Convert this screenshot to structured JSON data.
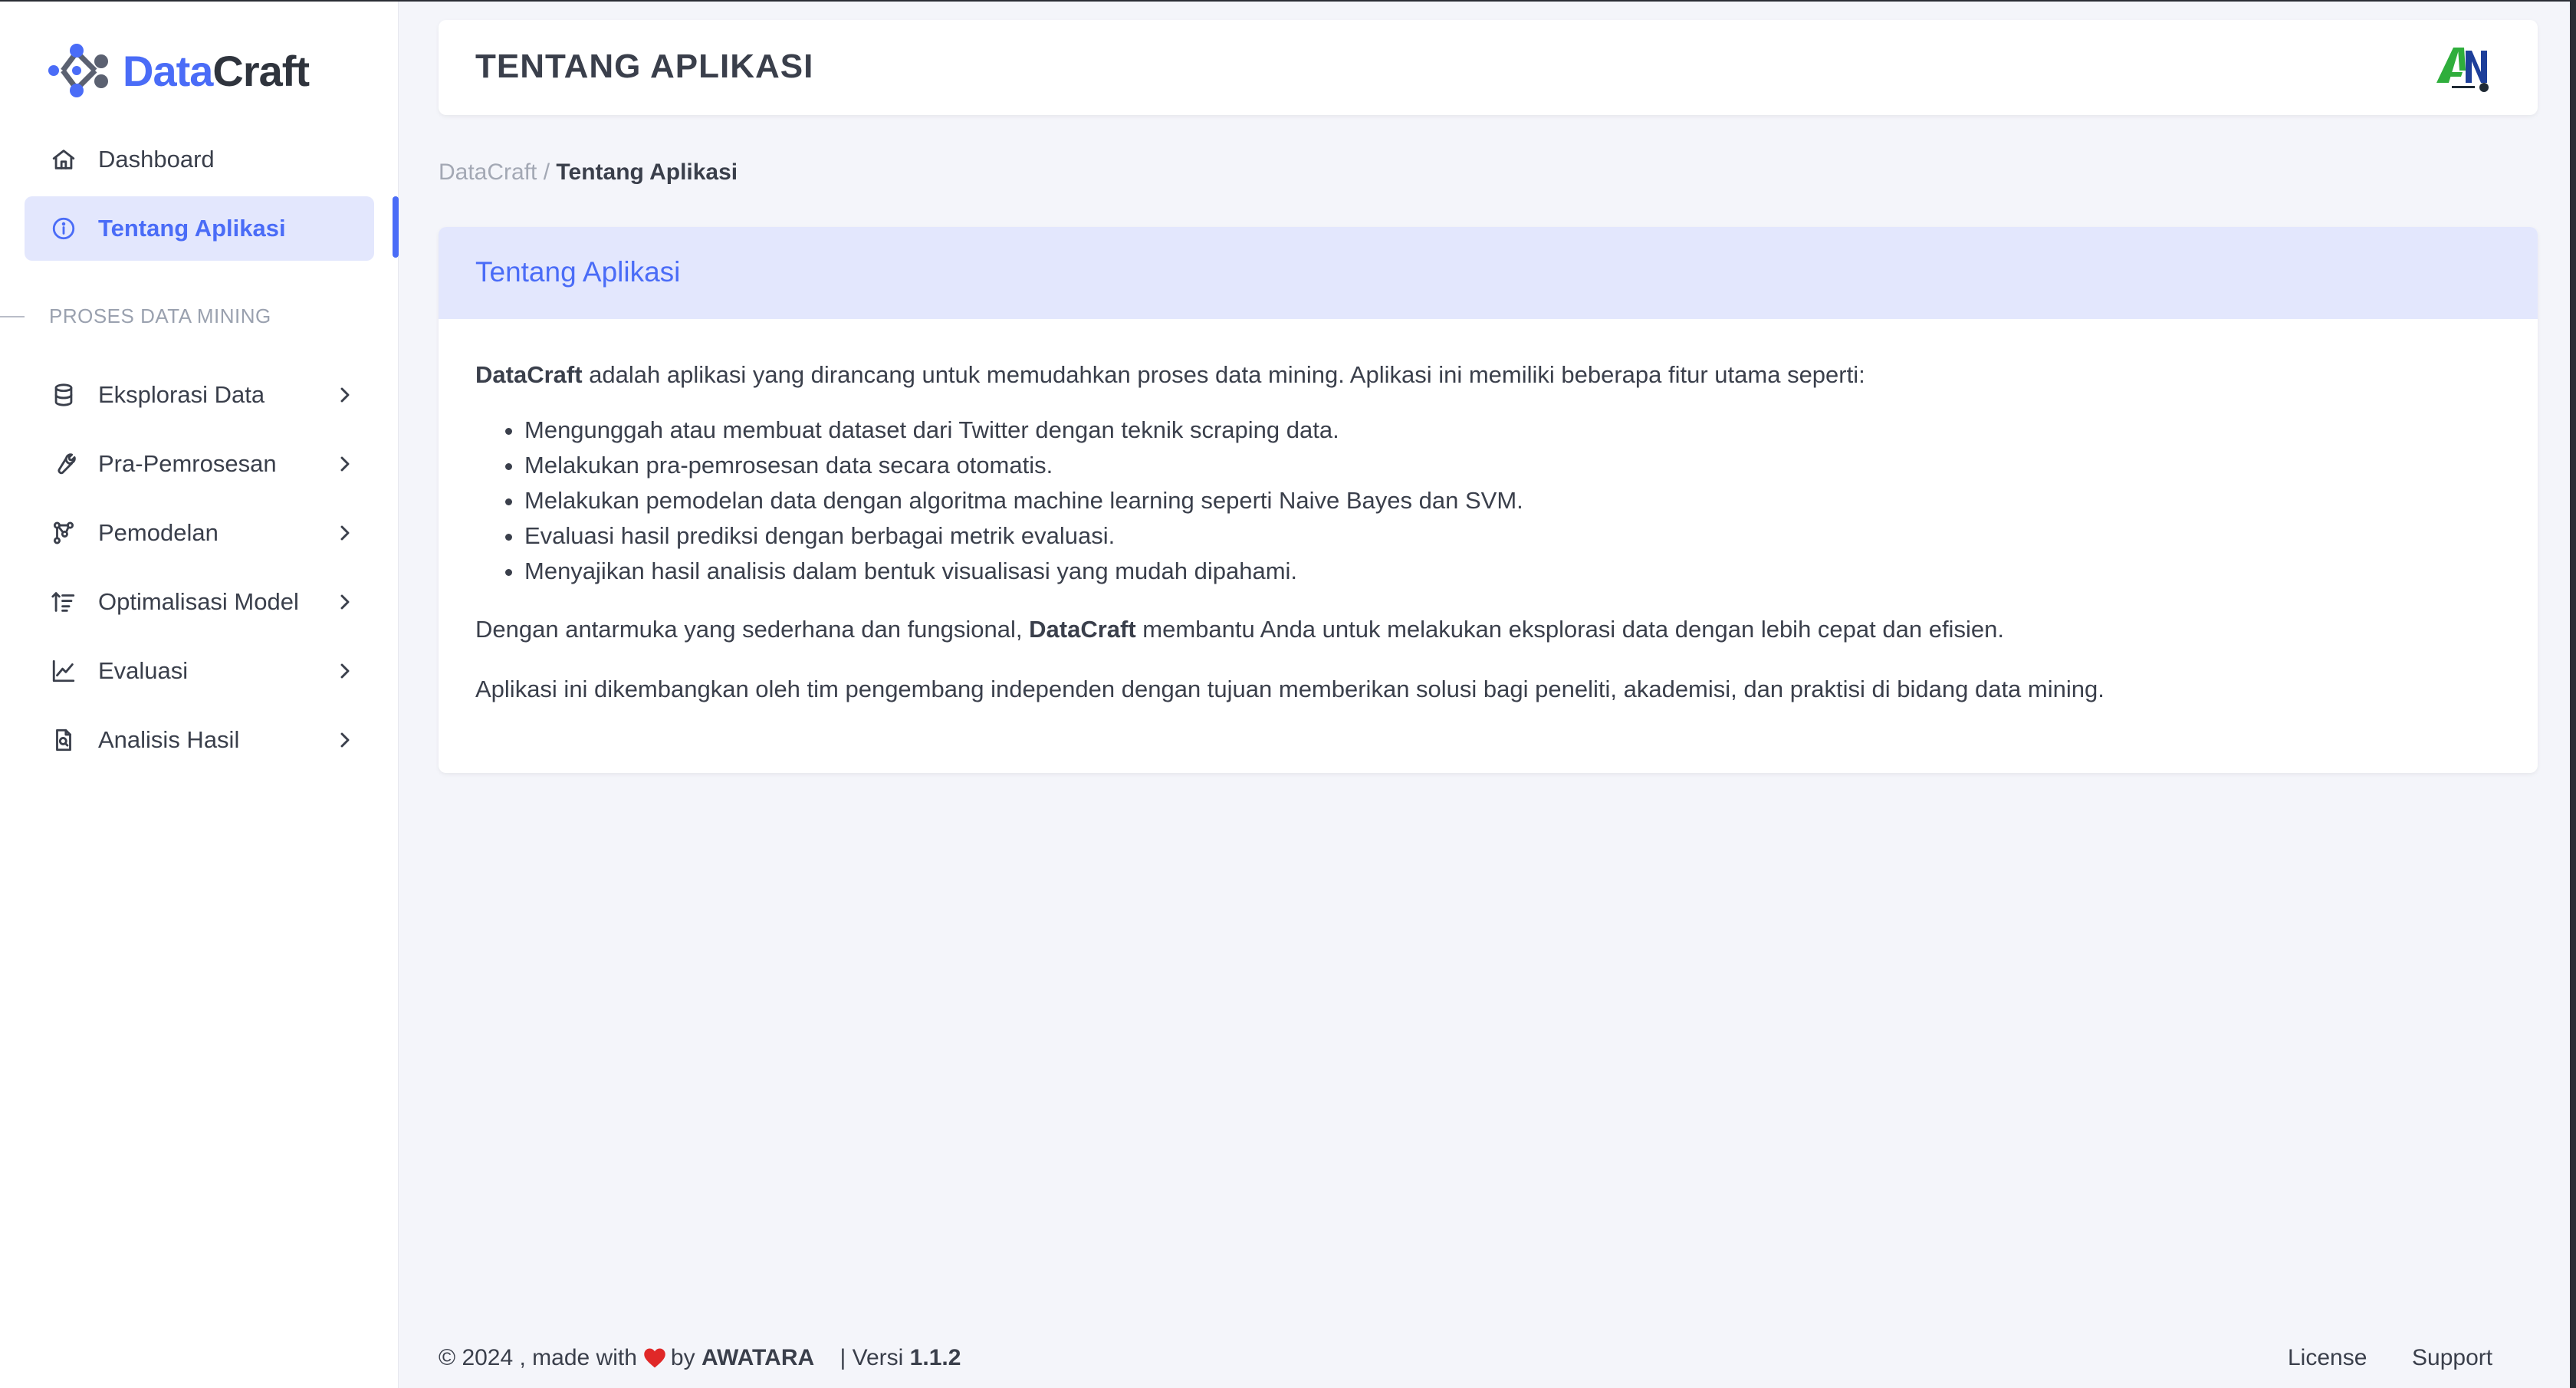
{
  "brand": {
    "part1": "Data",
    "part2": "Craft"
  },
  "sidebar": {
    "items": [
      {
        "label": "Dashboard",
        "icon": "home-icon"
      },
      {
        "label": "Tentang Aplikasi",
        "icon": "info-icon",
        "active": true
      }
    ],
    "section_title": "PROSES DATA MINING",
    "section_items": [
      {
        "label": "Eksplorasi Data",
        "icon": "database-icon"
      },
      {
        "label": "Pra-Pemrosesan",
        "icon": "wrench-icon"
      },
      {
        "label": "Pemodelan",
        "icon": "graph-nodes-icon"
      },
      {
        "label": "Optimalisasi Model",
        "icon": "sort-ascending-icon"
      },
      {
        "label": "Evaluasi",
        "icon": "line-chart-icon"
      },
      {
        "label": "Analisis Hasil",
        "icon": "file-search-icon"
      }
    ]
  },
  "header": {
    "title": "TENTANG APLIKASI",
    "logo_icon": "awatara-logo-icon"
  },
  "breadcrumb": {
    "root": "DataCraft",
    "separator": "/",
    "current": "Tentang Aplikasi"
  },
  "card": {
    "title": "Tentang Aplikasi",
    "intro_bold": "DataCraft",
    "intro_rest": " adalah aplikasi yang dirancang untuk memudahkan proses data mining. Aplikasi ini memiliki beberapa fitur utama seperti:",
    "features": [
      "Mengunggah atau membuat dataset dari Twitter dengan teknik scraping data.",
      "Melakukan pra-pemrosesan data secara otomatis.",
      "Melakukan pemodelan data dengan algoritma machine learning seperti Naive Bayes dan SVM.",
      "Evaluasi hasil prediksi dengan berbagai metrik evaluasi.",
      "Menyajikan hasil analisis dalam bentuk visualisasi yang mudah dipahami."
    ],
    "para2_start": "Dengan antarmuka yang sederhana dan fungsional, ",
    "para2_bold": "DataCraft",
    "para2_end": " membantu Anda untuk melakukan eksplorasi data dengan lebih cepat dan efisien.",
    "para3": "Aplikasi ini dikembangkan oleh tim pengembang independen dengan tujuan memberikan solusi bagi peneliti, akademisi, dan praktisi di bidang data mining."
  },
  "footer": {
    "copyright": "© 2024 , made with",
    "by": "by",
    "author": "AWATARA",
    "version_label": "| Versi",
    "version": "1.1.2",
    "links": [
      "License",
      "Support"
    ]
  },
  "colors": {
    "accent": "#4a6cf7",
    "accent_bg": "#e3e7fd",
    "heart": "#e02828"
  }
}
